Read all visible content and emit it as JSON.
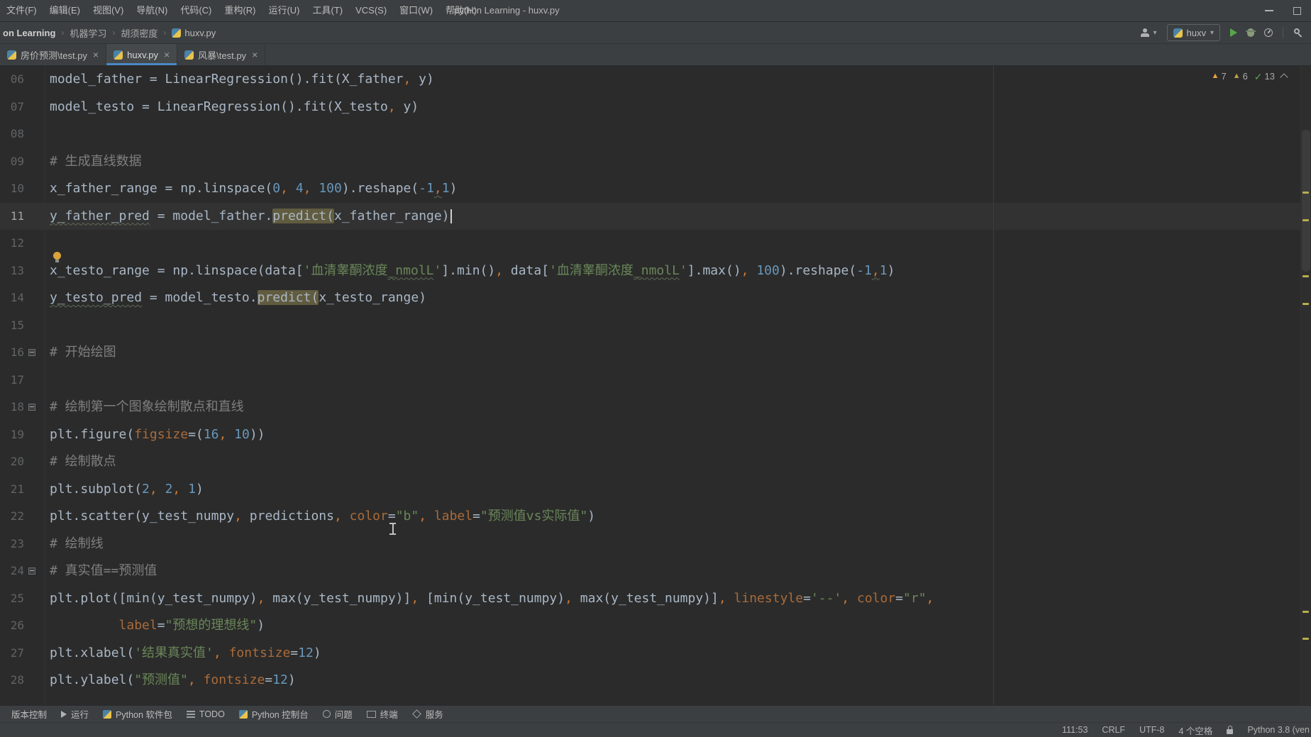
{
  "window": {
    "title": "python Learning - huxv.py"
  },
  "menubar": {
    "items": [
      "文件(F)",
      "编辑(E)",
      "视图(V)",
      "导航(N)",
      "代码(C)",
      "重构(R)",
      "运行(U)",
      "工具(T)",
      "VCS(S)",
      "窗口(W)",
      "帮助(H)"
    ]
  },
  "breadcrumb": {
    "items": [
      "on Learning",
      "机器学习",
      "胡须密度"
    ],
    "file": "huxv.py"
  },
  "run": {
    "config": "huxv"
  },
  "tabs": [
    {
      "label": "房价预测\\test.py",
      "active": false
    },
    {
      "label": "huxv.py",
      "active": true
    },
    {
      "label": "风暴\\test.py",
      "active": false
    }
  ],
  "inspections": {
    "warnings": "7",
    "weak": "6",
    "passed": "13"
  },
  "icons": {
    "close": "×",
    "chevron_down": "▾",
    "breadcrumb_separator": "›",
    "warning": "▲",
    "check": "✓"
  },
  "colors": {
    "accent_blue": "#4A88C7",
    "warning_yellow": "#E8A33D",
    "ok_green": "#5E9C5E",
    "run_green": "#57A64A",
    "occurrence_olive": "#615C3F"
  },
  "editor": {
    "lines": [
      {
        "num": "06",
        "segs": [
          [
            "model_father = LinearRegression().fit(X_father",
            "d"
          ],
          [
            ",",
            "m"
          ],
          [
            " y)",
            "d"
          ]
        ]
      },
      {
        "num": "07",
        "segs": [
          [
            "model_testo = LinearRegression().fit(X_testo",
            "d"
          ],
          [
            ",",
            "m"
          ],
          [
            " y)",
            "d"
          ]
        ]
      },
      {
        "num": "08",
        "segs": []
      },
      {
        "num": "09",
        "segs": [
          [
            "# 生成直线数据",
            "c"
          ]
        ]
      },
      {
        "num": "10",
        "segs": [
          [
            "x_father_range = np.linspace(",
            "d"
          ],
          [
            "0",
            "n"
          ],
          [
            ",",
            "m"
          ],
          [
            " ",
            "d"
          ],
          [
            "4",
            "n"
          ],
          [
            ",",
            "m"
          ],
          [
            " ",
            "d"
          ],
          [
            "100",
            "n"
          ],
          [
            ").reshape(",
            "d"
          ],
          [
            "-1",
            "n"
          ],
          [
            ",",
            "m ty"
          ],
          [
            "1",
            "n"
          ],
          [
            ")",
            "d"
          ]
        ]
      },
      {
        "num": "11",
        "current": true,
        "segs": [
          [
            "y_father_pred",
            "d ty"
          ],
          [
            " = model_father.",
            "d"
          ],
          [
            "predict(",
            "d hl"
          ],
          [
            "x_father_range",
            "d"
          ],
          [
            ")",
            "d"
          ],
          [
            "",
            "caret"
          ]
        ]
      },
      {
        "num": "12",
        "segs": []
      },
      {
        "num": "13",
        "segs": [
          [
            "x_testo_range = np.linspace(data[",
            "d"
          ],
          [
            "'血清睾酮浓度",
            "s"
          ],
          [
            "_nmolL",
            "s ty"
          ],
          [
            "'",
            "s"
          ],
          [
            "].min()",
            "d"
          ],
          [
            ",",
            "m"
          ],
          [
            " data[",
            "d"
          ],
          [
            "'血清睾酮浓度",
            "s"
          ],
          [
            "_nmolL",
            "s ty"
          ],
          [
            "'",
            "s"
          ],
          [
            "].max()",
            "d"
          ],
          [
            ",",
            "m"
          ],
          [
            " ",
            "d"
          ],
          [
            "100",
            "n"
          ],
          [
            ").reshape(",
            "d"
          ],
          [
            "-1",
            "n"
          ],
          [
            ",",
            "m ty"
          ],
          [
            "1",
            "n"
          ],
          [
            ")",
            "d"
          ]
        ]
      },
      {
        "num": "14",
        "segs": [
          [
            "y_testo_pred",
            "d ty"
          ],
          [
            " = model_testo.",
            "d"
          ],
          [
            "predict(",
            "d hl"
          ],
          [
            "x_testo_range)",
            "d"
          ]
        ]
      },
      {
        "num": "15",
        "segs": []
      },
      {
        "num": "16",
        "fold": true,
        "segs": [
          [
            "# 开始绘图",
            "c"
          ]
        ]
      },
      {
        "num": "17",
        "segs": []
      },
      {
        "num": "18",
        "fold": true,
        "segs": [
          [
            "# 绘制第一个图象绘制散点和直线",
            "c"
          ]
        ]
      },
      {
        "num": "19",
        "segs": [
          [
            "plt.figure(",
            "d"
          ],
          [
            "figsize",
            "k"
          ],
          [
            "=(",
            "d"
          ],
          [
            "16",
            "n"
          ],
          [
            ",",
            "m"
          ],
          [
            " ",
            "d"
          ],
          [
            "10",
            "n"
          ],
          [
            "))",
            "d"
          ]
        ]
      },
      {
        "num": "20",
        "segs": [
          [
            "# 绘制散点",
            "c"
          ]
        ]
      },
      {
        "num": "21",
        "segs": [
          [
            "plt.subplot(",
            "d"
          ],
          [
            "2",
            "n"
          ],
          [
            ",",
            "m"
          ],
          [
            " ",
            "d"
          ],
          [
            "2",
            "n"
          ],
          [
            ",",
            "m"
          ],
          [
            " ",
            "d"
          ],
          [
            "1",
            "n"
          ],
          [
            ")",
            "d"
          ]
        ]
      },
      {
        "num": "22",
        "segs": [
          [
            "plt.scatter(y_test_numpy",
            "d"
          ],
          [
            ",",
            "m"
          ],
          [
            " predictions",
            "d"
          ],
          [
            ",",
            "m"
          ],
          [
            " ",
            "d"
          ],
          [
            "color",
            "k"
          ],
          [
            "=",
            "d"
          ],
          [
            "\"b\"",
            "s"
          ],
          [
            ",",
            "m"
          ],
          [
            " ",
            "d"
          ],
          [
            "label",
            "k"
          ],
          [
            "=",
            "d"
          ],
          [
            "\"预测值vs实际值\"",
            "s"
          ],
          [
            ")",
            "d"
          ]
        ]
      },
      {
        "num": "23",
        "segs": [
          [
            "# 绘制线",
            "c"
          ]
        ]
      },
      {
        "num": "24",
        "fold": true,
        "segs": [
          [
            "# 真实值==预测值",
            "c"
          ]
        ]
      },
      {
        "num": "25",
        "segs": [
          [
            "plt.plot([min(y_test_numpy)",
            "d"
          ],
          [
            ",",
            "m"
          ],
          [
            " max(y_test_numpy)]",
            "d"
          ],
          [
            ",",
            "m"
          ],
          [
            " [min(y_test_numpy)",
            "d"
          ],
          [
            ",",
            "m"
          ],
          [
            " max(y_test_numpy)]",
            "d"
          ],
          [
            ",",
            "m"
          ],
          [
            " ",
            "d"
          ],
          [
            "linestyle",
            "k"
          ],
          [
            "=",
            "d"
          ],
          [
            "'--'",
            "s"
          ],
          [
            ",",
            "m"
          ],
          [
            " ",
            "d"
          ],
          [
            "color",
            "k"
          ],
          [
            "=",
            "d"
          ],
          [
            "\"r\"",
            "s"
          ],
          [
            ",",
            "m"
          ]
        ]
      },
      {
        "num": "26",
        "segs": [
          [
            "         ",
            "d"
          ],
          [
            "label",
            "k"
          ],
          [
            "=",
            "d"
          ],
          [
            "\"预想的理想线\"",
            "s"
          ],
          [
            ")",
            "d"
          ]
        ]
      },
      {
        "num": "27",
        "segs": [
          [
            "plt.xlabel(",
            "d"
          ],
          [
            "'结果真实值'",
            "s"
          ],
          [
            ",",
            "m"
          ],
          [
            " ",
            "d"
          ],
          [
            "fontsize",
            "k"
          ],
          [
            "=",
            "d"
          ],
          [
            "12",
            "n"
          ],
          [
            ")",
            "d"
          ]
        ]
      },
      {
        "num": "28",
        "segs": [
          [
            "plt.ylabel(",
            "d"
          ],
          [
            "\"预测值\"",
            "s"
          ],
          [
            ",",
            "m"
          ],
          [
            " ",
            "d"
          ],
          [
            "fontsize",
            "k"
          ],
          [
            "=",
            "d"
          ],
          [
            "12",
            "n"
          ],
          [
            ")",
            "d"
          ]
        ]
      }
    ]
  },
  "toolbar_bottom": {
    "items": [
      {
        "icon": "",
        "label": "版本控制"
      },
      {
        "icon": "play",
        "label": "运行"
      },
      {
        "icon": "python",
        "label": "Python 软件包"
      },
      {
        "icon": "todo",
        "label": "TODO"
      },
      {
        "icon": "python",
        "label": "Python 控制台"
      },
      {
        "icon": "problem",
        "label": "问题"
      },
      {
        "icon": "terminal",
        "label": "终端"
      },
      {
        "icon": "services",
        "label": "服务"
      }
    ]
  },
  "statusbar": {
    "items": [
      "111:53",
      "CRLF",
      "UTF-8",
      "4 个空格",
      "Python 3.8 (ven"
    ]
  }
}
